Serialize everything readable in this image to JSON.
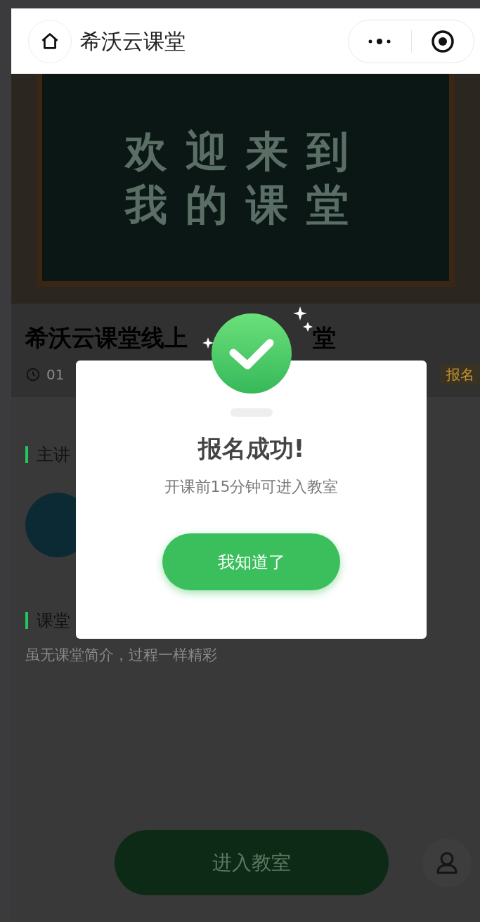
{
  "nav": {
    "title": "希沃云课堂"
  },
  "banner": {
    "lines": [
      "欢迎来到",
      "我的课堂"
    ]
  },
  "course": {
    "title_start": "希沃云课堂线上",
    "title_end": "堂",
    "time": "01",
    "badge": "报名"
  },
  "sections": [
    {
      "heading": "主讲"
    },
    {
      "heading": "课堂",
      "text": "虽无课堂简介，过程一样精彩"
    }
  ],
  "enter_button": "进入教室",
  "dialog": {
    "title": "报名成功!",
    "message": "开课前15分钟可进入教室",
    "button": "我知道了"
  }
}
